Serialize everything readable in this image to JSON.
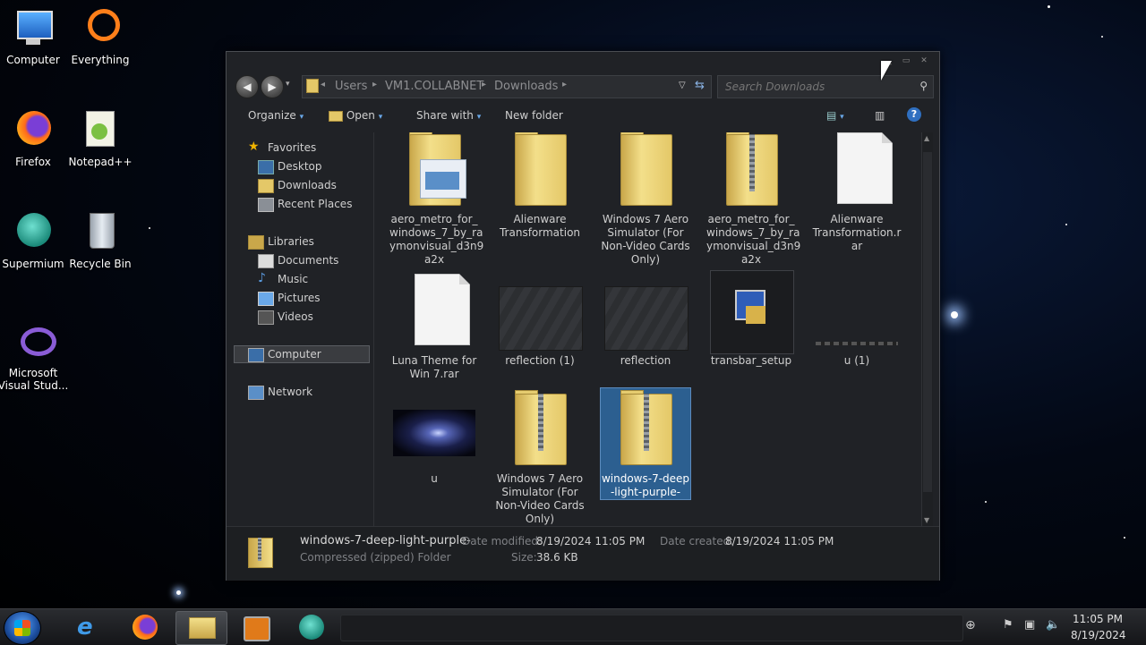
{
  "desktop": {
    "icons": [
      {
        "label": "Computer",
        "icon": "computer-icon"
      },
      {
        "label": "Everything",
        "icon": "everything-icon"
      },
      {
        "label": "Firefox",
        "icon": "firefox-icon"
      },
      {
        "label": "Notepad++",
        "icon": "notepad-plus-plus-icon"
      },
      {
        "label": "Supermium",
        "icon": "supermium-icon"
      },
      {
        "label": "Recycle Bin",
        "icon": "recycle-bin-icon"
      },
      {
        "label": "Microsoft Visual Stud...",
        "icon": "visual-studio-icon"
      }
    ]
  },
  "explorer": {
    "breadcrumb": [
      "Users",
      "VM1.COLLABNET",
      "Downloads"
    ],
    "search_placeholder": "Search Downloads",
    "toolbar": {
      "organize": "Organize",
      "open": "Open",
      "share_with": "Share with",
      "new_folder": "New folder"
    },
    "nav": {
      "favorites": "Favorites",
      "favorites_items": [
        "Desktop",
        "Downloads",
        "Recent Places"
      ],
      "libraries": "Libraries",
      "libraries_items": [
        "Documents",
        "Music",
        "Pictures",
        "Videos"
      ],
      "computer": "Computer",
      "network": "Network"
    },
    "files": [
      {
        "name": "aero_metro_for_ windows_7_by_ra ymonvisual_d3n9 a2x",
        "kind": "folder-with-image"
      },
      {
        "name": "Alienware Transformation",
        "kind": "folder"
      },
      {
        "name": "Windows 7 Aero Simulator (For Non-Video Cards Only)",
        "kind": "folder"
      },
      {
        "name": "aero_metro_for_ windows_7_by_ra ymonvisual_d3n9 a2x",
        "kind": "zip"
      },
      {
        "name": "Alienware Transformation.r ar",
        "kind": "file"
      },
      {
        "name": "Luna Theme for Win 7.rar",
        "kind": "file"
      },
      {
        "name": "reflection (1)",
        "kind": "image"
      },
      {
        "name": "reflection",
        "kind": "image"
      },
      {
        "name": "transbar_setup",
        "kind": "setup"
      },
      {
        "name": "u (1)",
        "kind": "thin-image"
      },
      {
        "name": "u",
        "kind": "galaxy"
      },
      {
        "name": "Windows 7 Aero Simulator (For Non-Video Cards Only)",
        "kind": "zip"
      },
      {
        "name": "windows-7-deep -light-purple-",
        "kind": "zip",
        "selected": true
      }
    ],
    "status": {
      "name": "windows-7-deep-light-purple-",
      "type": "Compressed (zipped) Folder",
      "date_modified_label": "Date modified:",
      "date_modified": "8/19/2024 11:05 PM",
      "date_created_label": "Date created:",
      "date_created": "8/19/2024 11:05 PM",
      "size_label": "Size:",
      "size": "38.6 KB"
    }
  },
  "taskbar": {
    "time": "11:05 PM",
    "date": "8/19/2024"
  },
  "colors": {
    "selection": "#2c5f90",
    "window_bg": "#202226"
  }
}
